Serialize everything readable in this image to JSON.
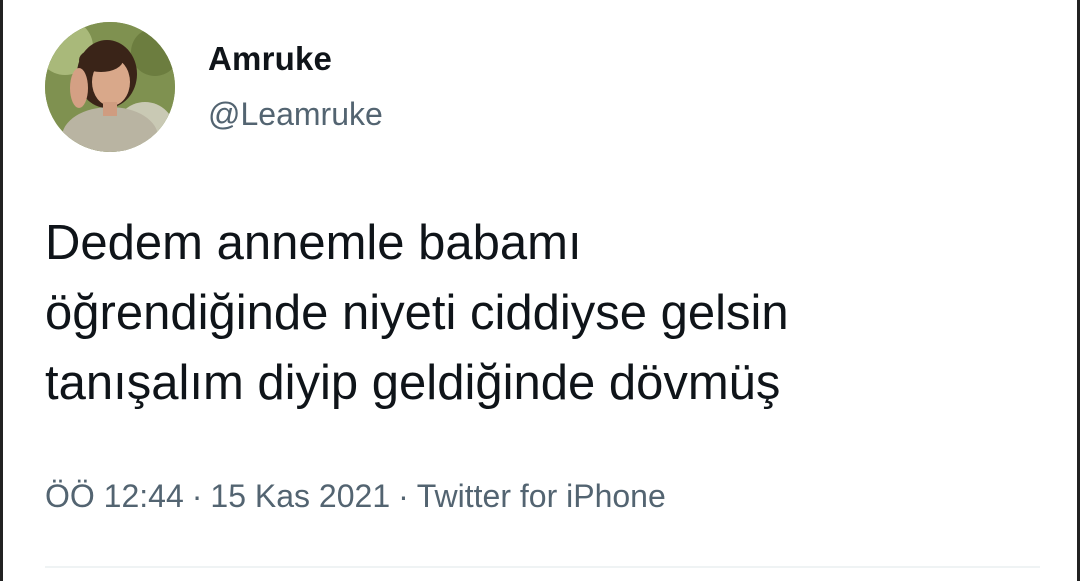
{
  "user": {
    "display_name": "Amruke",
    "handle": "@Leamruke",
    "avatar_icon": "profile-photo"
  },
  "tweet": {
    "lines": [
      "Dedem annemle babamı",
      "öğrendiğinde niyeti ciddiyse gelsin",
      "tanışalım diyip geldiğinde dövmüş"
    ]
  },
  "meta": {
    "time": "ÖÖ 12:44",
    "separator": "·",
    "date": "15 Kas 2021",
    "source": "Twitter for iPhone"
  },
  "colors": {
    "text": "#0f1419",
    "secondary": "#536471",
    "divider": "#eff3f4"
  }
}
